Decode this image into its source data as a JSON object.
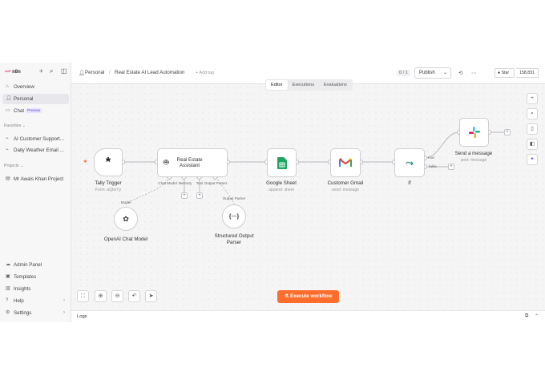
{
  "brand": {
    "name": "n8n"
  },
  "sidebar": {
    "items": [
      {
        "label": "Overview",
        "icon": "home-icon"
      },
      {
        "label": "Personal",
        "icon": "user-icon"
      },
      {
        "label": "Chat",
        "icon": "chat-icon",
        "badge": "Preview"
      }
    ],
    "favorites_label": "Favorites",
    "favorites": [
      "AI Customer Support...",
      "Daily Weather Email ..."
    ],
    "projects_label": "Projects",
    "projects": [
      "Mr Awais Khan Project"
    ],
    "bottom": [
      {
        "label": "Admin Panel",
        "icon": "cloud-icon"
      },
      {
        "label": "Templates",
        "icon": "box-icon"
      },
      {
        "label": "Insights",
        "icon": "chart-icon"
      },
      {
        "label": "Help",
        "icon": "help-icon"
      },
      {
        "label": "Settings",
        "icon": "gear-icon"
      }
    ]
  },
  "header": {
    "breadcrumb_project": "Personal",
    "separator": "/",
    "workflow_name": "Real Estate AI Lead Automation",
    "add_tag": "+ Add tag",
    "counter": "0 / 1",
    "publish_label": "Publish",
    "star_label": "Star",
    "star_count": "158,831"
  },
  "tabs": [
    "Editor",
    "Executions",
    "Evaluations"
  ],
  "active_tab": "Editor",
  "nodes": {
    "tally": {
      "title": "Tally Trigger",
      "subtitle": "Form: aQbxYy"
    },
    "agent": {
      "title": "Real Estate Assistant"
    },
    "sheet": {
      "title": "Google Sheet",
      "subtitle": "append: sheet"
    },
    "gmail": {
      "title": "Customer Gmail",
      "subtitle": "send: message"
    },
    "if": {
      "title": "If"
    },
    "slack": {
      "title": "Send a message",
      "subtitle": "post: message"
    },
    "openai": {
      "title": "OpenAI Chat Model"
    },
    "parser": {
      "title": "Structured Output Parser"
    }
  },
  "ports": {
    "chat_model": "Chat Model",
    "memory": "Memory",
    "tool": "Tool",
    "output_parser": "Output Parser",
    "model": "Model",
    "output_parser_link": "Output Parser",
    "true": "true",
    "false": "false"
  },
  "execute_label": "Execute workflow",
  "logs_label": "Logs",
  "colors": {
    "accent": "#ff6d2c",
    "brand": "#ea4b71"
  }
}
